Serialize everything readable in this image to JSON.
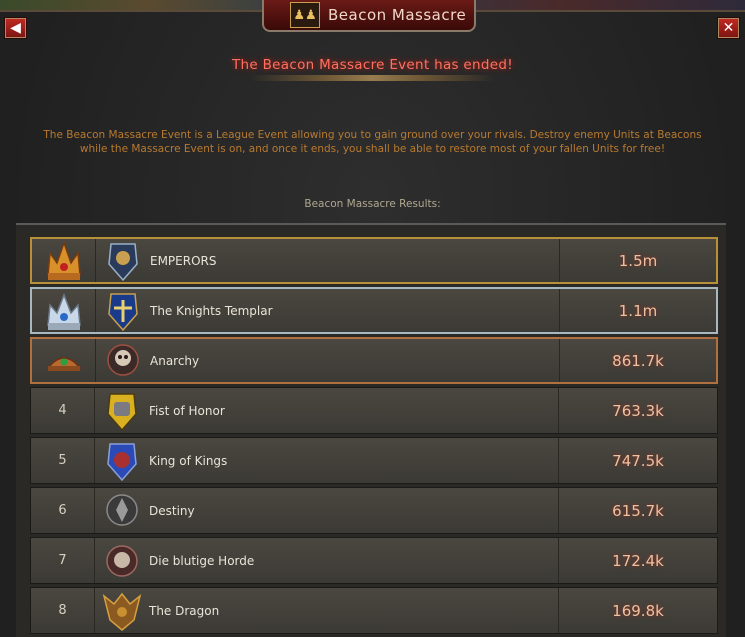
{
  "window": {
    "title": "Beacon Massacre",
    "back_icon": "arrow-left-icon",
    "close_icon": "close-icon"
  },
  "status": "The Beacon Massacre Event has ended!",
  "description": "The Beacon Massacre Event is a League Event allowing you to gain ground over your rivals. Destroy enemy Units at Beacons while the Massacre Event is on, and once it ends, you shall be able to restore most of your fallen Units for free!",
  "results_label": "Beacon Massacre Results:",
  "results": [
    {
      "rank": "",
      "badge": "gold-crown",
      "name": "EMPERORS",
      "score": "1.5m"
    },
    {
      "rank": "",
      "badge": "silver-crown",
      "name": "The Knights Templar",
      "score": "1.1m"
    },
    {
      "rank": "",
      "badge": "bronze-crown",
      "name": "Anarchy",
      "score": "861.7k"
    },
    {
      "rank": "4",
      "badge": "",
      "name": "Fist of Honor",
      "score": "763.3k"
    },
    {
      "rank": "5",
      "badge": "",
      "name": "King of Kings",
      "score": "747.5k"
    },
    {
      "rank": "6",
      "badge": "",
      "name": "Destiny",
      "score": "615.7k"
    },
    {
      "rank": "7",
      "badge": "",
      "name": "Die blutige Horde",
      "score": "172.4k"
    },
    {
      "rank": "8",
      "badge": "",
      "name": "The Dragon",
      "score": "169.8k"
    }
  ],
  "colors": {
    "status": "#ff7060",
    "description": "#b87a30",
    "gold": "#b8903a",
    "silver": "#a8b8c0",
    "bronze": "#b07040"
  }
}
